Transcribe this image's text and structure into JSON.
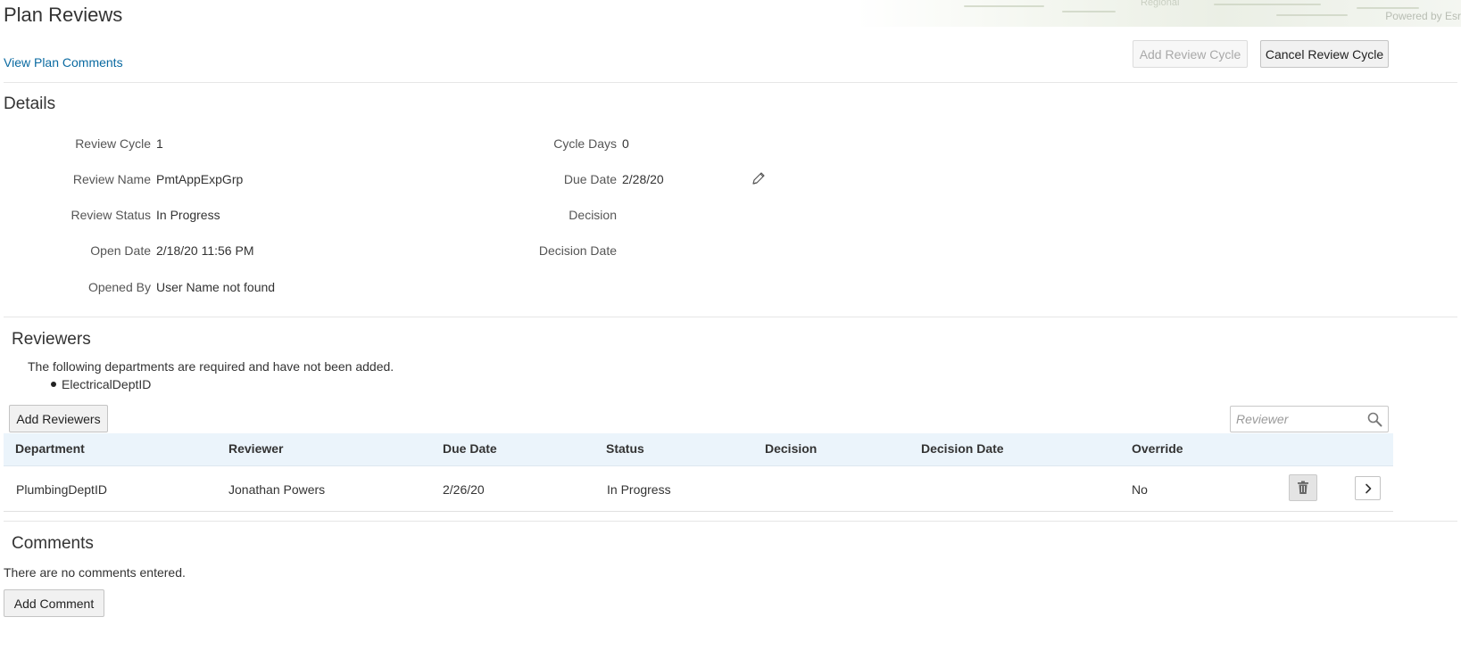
{
  "header": {
    "title": "Plan Reviews",
    "view_comments_link": "View Plan Comments",
    "add_review_cycle": "Add Review Cycle",
    "cancel_review_cycle": "Cancel Review Cycle",
    "map_region_text": "Regional",
    "map_credit": "Powered by Esr"
  },
  "details": {
    "title": "Details",
    "left": [
      {
        "label": "Review Cycle",
        "value": "1"
      },
      {
        "label": "Review Name",
        "value": "PmtAppExpGrp"
      },
      {
        "label": "Review Status",
        "value": "In Progress"
      },
      {
        "label": "Open Date",
        "value": "2/18/20 11:56 PM"
      },
      {
        "label": "Opened By",
        "value": "User Name not found"
      }
    ],
    "right": [
      {
        "label": "Cycle Days",
        "value": "0"
      },
      {
        "label": "Due Date",
        "value": "2/28/20"
      },
      {
        "label": "Decision",
        "value": ""
      },
      {
        "label": "Decision Date",
        "value": ""
      }
    ],
    "edit_icon": "pencil-icon"
  },
  "reviewers": {
    "title": "Reviewers",
    "notice": "The following departments are required and have not been added.",
    "missing_departments": [
      "ElectricalDeptID"
    ],
    "add_button": "Add Reviewers",
    "search_placeholder": "Reviewer",
    "search_icon": "search-icon",
    "columns": [
      "Department",
      "Reviewer",
      "Due Date",
      "Status",
      "Decision",
      "Decision Date",
      "Override"
    ],
    "rows": [
      {
        "department": "PlumbingDeptID",
        "reviewer": "Jonathan Powers",
        "due_date": "2/26/20",
        "status": "In Progress",
        "decision": "",
        "decision_date": "",
        "override": "No"
      }
    ],
    "row_icons": [
      "trash-icon",
      "chevron-right-icon"
    ]
  },
  "comments": {
    "title": "Comments",
    "empty_text": "There are no comments entered.",
    "add_button": "Add Comment"
  }
}
